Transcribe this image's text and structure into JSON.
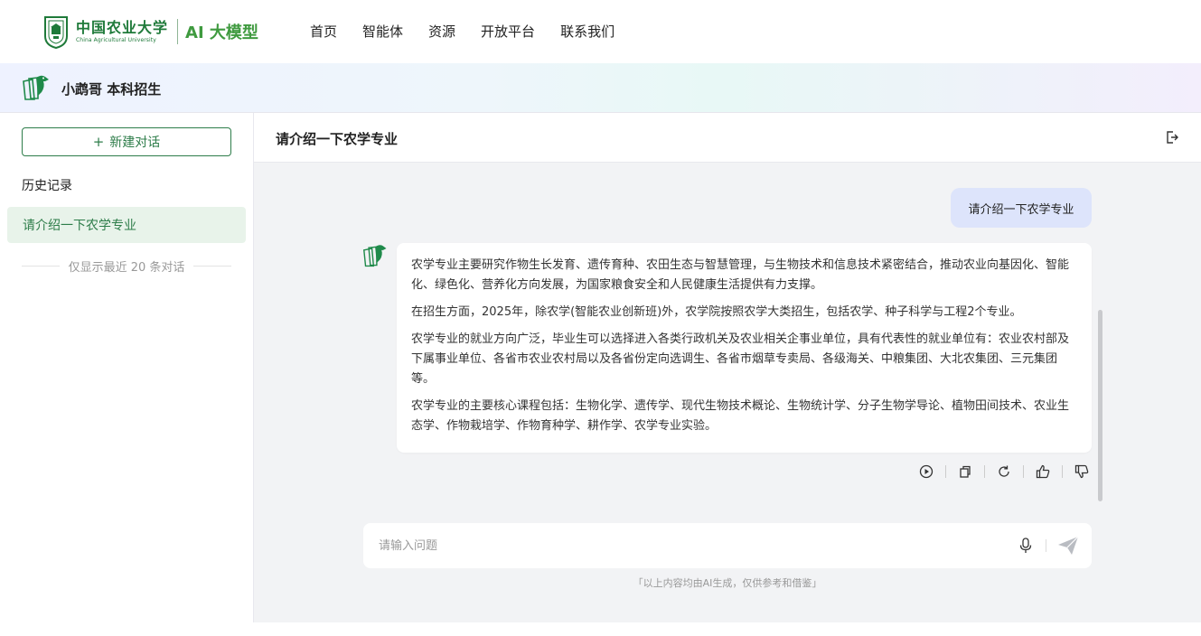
{
  "header": {
    "university_cn": "中国农业大学",
    "university_en": "China Agricultural University",
    "product": "AI 大模型",
    "nav": [
      "首页",
      "智能体",
      "资源",
      "开放平台",
      "联系我们"
    ]
  },
  "agent": {
    "name": "小鹉哥 本科招生"
  },
  "sidebar": {
    "new_chat": "新建对话",
    "history_title": "历史记录",
    "history_items": [
      "请介绍一下农学专业"
    ],
    "history_note": "仅显示最近 20 条对话"
  },
  "chat": {
    "title": "请介绍一下农学专业",
    "user_message": "请介绍一下农学专业",
    "bot_paragraphs": [
      "农学专业主要研究作物生长发育、遗传育种、农田生态与智慧管理，与生物技术和信息技术紧密结合，推动农业向基因化、智能化、绿色化、营养化方向发展，为国家粮食安全和人民健康生活提供有力支撑。",
      "在招生方面，2025年，除农学(智能农业创新班)外，农学院按照农学大类招生，包括农学、种子科学与工程2个专业。",
      "农学专业的就业方向广泛，毕业生可以选择进入各类行政机关及农业相关企事业单位，具有代表性的就业单位有：农业农村部及下属事业单位、各省市农业农村局以及各省份定向选调生、各省市烟草专卖局、各级海关、中粮集团、大北农集团、三元集团等。",
      "农学专业的主要核心课程包括：生物化学、遗传学、现代生物技术概论、生物统计学、分子生物学导论、植物田间技术、农业生态学、作物栽培学、作物育种学、耕作学、农学专业实验。"
    ],
    "input_placeholder": "请输入问题",
    "input_value": "",
    "disclaimer": "「以上内容均由AI生成，仅供参考和借鉴」"
  },
  "colors": {
    "brand_green": "#2e7d4a",
    "ai_green": "#3f9a3f",
    "user_bubble": "#dde4fb",
    "history_active_bg": "#e8f3ea"
  },
  "icons": [
    "university-seal-icon",
    "agent-logo-icon",
    "plus-icon",
    "logout-icon",
    "play-icon",
    "copy-icon",
    "refresh-icon",
    "thumbs-up-icon",
    "thumbs-down-icon",
    "microphone-icon",
    "send-icon"
  ]
}
